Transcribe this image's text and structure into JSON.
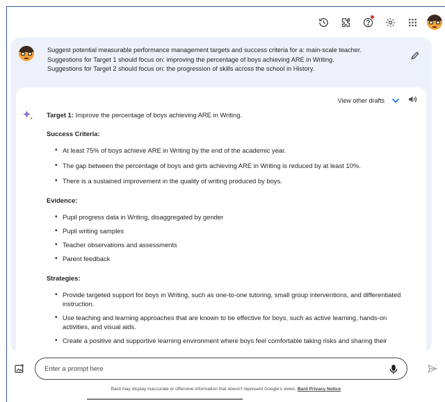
{
  "topbar": {
    "icons": [
      "history-icon",
      "extensions-icon",
      "help-icon",
      "settings-icon",
      "apps-grid-icon"
    ],
    "user": "avatar"
  },
  "prompt": {
    "lines": [
      "Suggest potential measurable performance management targets and success criteria for a: main-scale teacher.",
      "Suggestions for Target 1 should focus on: improving the percentage of boys achieving ARE in Writing.",
      "Suggestions for Target 2 should focus on: the progression of skills across the school in History."
    ]
  },
  "response": {
    "drafts_label": "View other drafts",
    "target_label": "Target 1:",
    "target_text": " Improve the percentage of boys achieving ARE in Writing.",
    "sections": [
      {
        "heading": "Success Criteria:",
        "items": [
          "At least 75% of boys achieve ARE in Writing by the end of the academic year.",
          "The gap between the percentage of boys and girls achieving ARE in Writing is reduced by at least 10%.",
          "There is a sustained improvement in the quality of writing produced by boys."
        ]
      },
      {
        "heading": "Evidence:",
        "items": [
          "Pupil progress data in Writing, disaggregated by gender",
          "Pupil writing samples",
          "Teacher observations and assessments",
          "Parent feedback"
        ]
      },
      {
        "heading": "Strategies:",
        "items": [
          "Provide targeted support for boys in Writing, such as one-to-one tutoring, small group interventions, and differentiated instruction.",
          "Use teaching and learning approaches that are known to be effective for boys, such as active learning, hands-on activities, and visual aids.",
          "Create a positive and supportive learning environment where boys feel comfortable taking risks and sharing their"
        ]
      }
    ]
  },
  "composer": {
    "placeholder": "Enter a prompt here"
  },
  "footer": {
    "disclaimer": "Bard may display inaccurate or offensive information that doesn't represent Google's views. ",
    "privacy_link": "Bard Privacy Notice"
  },
  "colors": {
    "chat_bg": "#edf2fa",
    "frame_border": "#2f5597",
    "accent": "#1a73e8",
    "notification_dot": "#d93025"
  }
}
